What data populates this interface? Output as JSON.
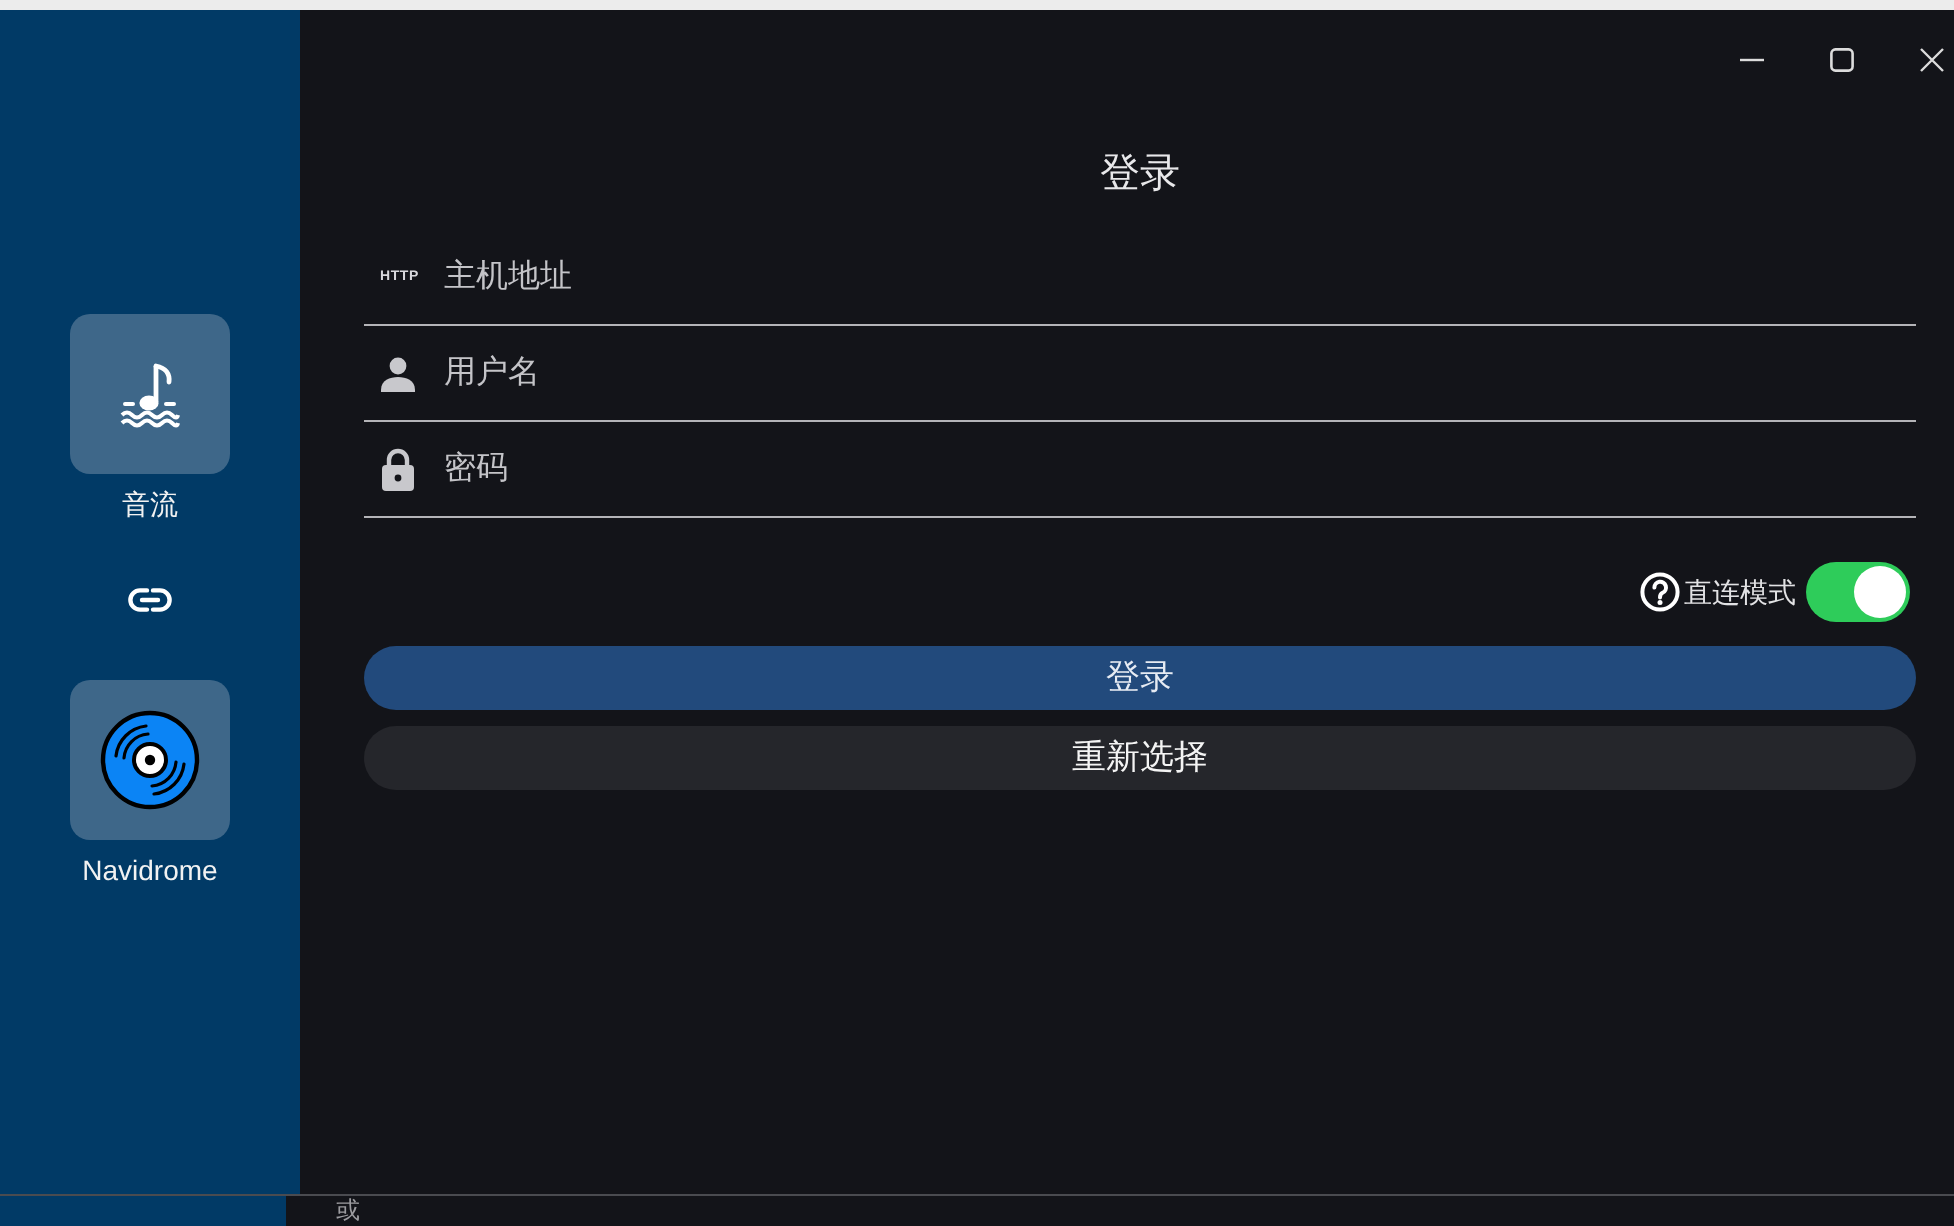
{
  "sidebar": {
    "items": [
      {
        "kind": "stream",
        "label": "音流"
      },
      {
        "kind": "disc",
        "label": "Navidrome"
      }
    ]
  },
  "login": {
    "title": "登录",
    "fields": [
      {
        "kind": "host",
        "prefix": "HTTP",
        "placeholder": "主机地址"
      },
      {
        "kind": "user",
        "placeholder": "用户名"
      },
      {
        "kind": "password",
        "placeholder": "密码"
      }
    ],
    "direct_mode": {
      "label": "直连模式",
      "on": true
    },
    "buttons": [
      {
        "kind": "primary",
        "label": "登录"
      },
      {
        "kind": "secondary",
        "label": "重新选择"
      }
    ]
  },
  "background": {
    "text": "或"
  }
}
